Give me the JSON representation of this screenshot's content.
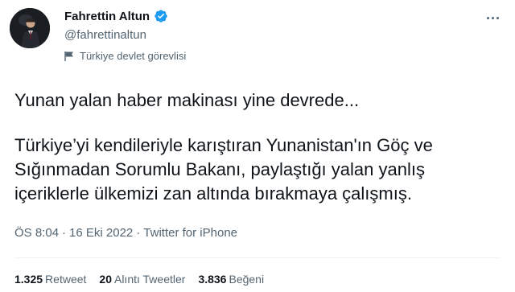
{
  "author": {
    "name": "Fahrettin Altun",
    "handle": "@fahrettinaltun",
    "label": "Türkiye devlet görevlisi",
    "verified_icon": "verified-badge-icon",
    "label_icon": "government-flag-icon"
  },
  "tweet": {
    "line1": "Yunan yalan haber makinası yine devrede...",
    "line2": "Türkiye’yi kendileriyle karıştıran Yunanistan'ın Göç ve Sığınmadan Sorumlu Bakanı, paylaştığı yalan yanlış içeriklerle ülkemizi zan altında bırakmaya çalışmış."
  },
  "meta": {
    "time": "ÖS 8:04",
    "date": "16 Eki 2022",
    "source": "Twitter for iPhone"
  },
  "stats": {
    "retweets": {
      "count": "1.325",
      "label": "Retweet"
    },
    "quotes": {
      "count": "20",
      "label": "Alıntı Tweetler"
    },
    "likes": {
      "count": "3.836",
      "label": "Beğeni"
    }
  },
  "colors": {
    "verified": "#1d9bf0",
    "text": "#0f1419",
    "secondary": "#536471"
  }
}
